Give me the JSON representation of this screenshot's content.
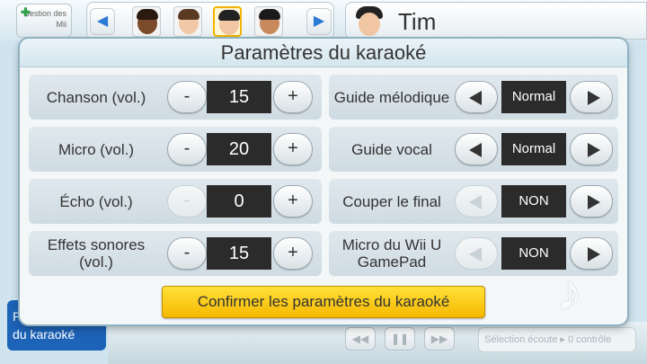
{
  "background": {
    "mii_management_label": "Gestion des Mii",
    "user_name": "Tim",
    "left_button_label": "du karaoké",
    "left_button_prefix": "P",
    "playback_hint": "Sélection écoute ▸  0 contrôle"
  },
  "dialog": {
    "title": "Paramètres du karaoké",
    "left_settings": [
      {
        "label": "Chanson (vol.)",
        "value": "15",
        "minus": "-",
        "plus": "+",
        "minus_disabled": false
      },
      {
        "label": "Micro (vol.)",
        "value": "20",
        "minus": "-",
        "plus": "+",
        "minus_disabled": false
      },
      {
        "label": "Écho (vol.)",
        "value": "0",
        "minus": "-",
        "plus": "+",
        "minus_disabled": true
      },
      {
        "label": "Effets sonores (vol.)",
        "value": "15",
        "minus": "-",
        "plus": "+",
        "minus_disabled": false
      }
    ],
    "right_settings": [
      {
        "label": "Guide mélodique",
        "value": "Normal",
        "left_disabled": false
      },
      {
        "label": "Guide vocal",
        "value": "Normal",
        "left_disabled": false
      },
      {
        "label": "Couper le final",
        "value": "NON",
        "left_disabled": true
      },
      {
        "label": "Micro du Wii U GamePad",
        "value": "NON",
        "left_disabled": true
      }
    ],
    "confirm_label": "Confirmer les paramètres du karaoké"
  },
  "colors": {
    "confirm_button": "#f6b800",
    "value_box": "#2b2b2b",
    "accent_blue": "#1d63b8"
  },
  "icons": [
    "plus-icon",
    "chevron-left-icon",
    "chevron-right-icon",
    "triangle-left-icon",
    "triangle-right-icon",
    "music-note-icon",
    "rewind-icon",
    "pause-icon",
    "fast-forward-icon"
  ]
}
